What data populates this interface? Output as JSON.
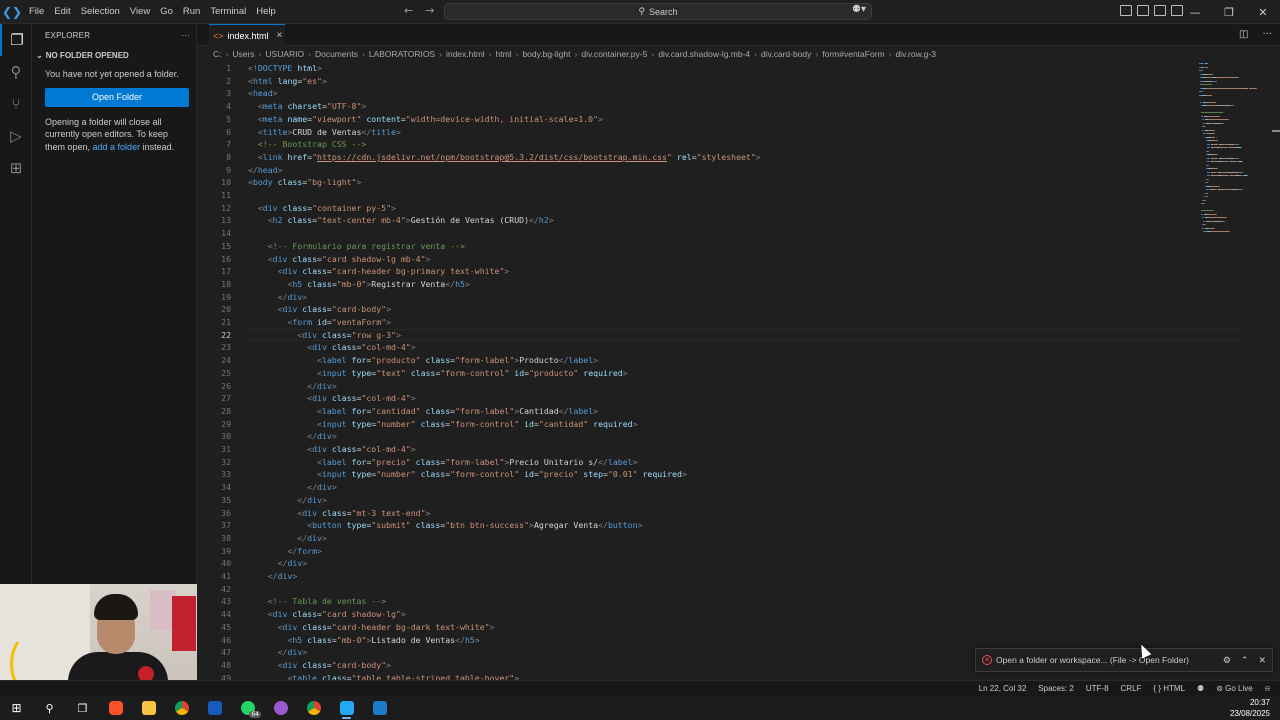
{
  "app": {
    "logo": "vscode-icon"
  },
  "menu": [
    "File",
    "Edit",
    "Selection",
    "View",
    "Go",
    "Run",
    "Terminal",
    "Help"
  ],
  "command_center": {
    "label": "Search"
  },
  "sidebar": {
    "title": "EXPLORER",
    "section": "NO FOLDER OPENED",
    "message": "You have not yet opened a folder.",
    "open_button": "Open Folder",
    "info_before": "Opening a folder will close all currently open editors. To keep them open, ",
    "info_link": "add a folder",
    "info_after": " instead."
  },
  "tab": {
    "label": "index.html",
    "close": "×"
  },
  "breadcrumb": [
    "C:",
    "Users",
    "USUARIO",
    "Documents",
    "LABORATORIOS",
    "index.html",
    "html",
    "body.bg-light",
    "div.container.py-5",
    "div.card.shadow-lg.mb-4",
    "div.card-body",
    "form#ventaForm",
    "div.row.g-3"
  ],
  "code_lines": [
    [
      [
        "p",
        "<!"
      ],
      [
        "t",
        "DOCTYPE"
      ],
      [
        "x",
        " "
      ],
      [
        "a",
        "html"
      ],
      [
        "p",
        ">"
      ]
    ],
    [
      [
        "p",
        "<"
      ],
      [
        "t",
        "html"
      ],
      [
        "x",
        " "
      ],
      [
        "a",
        "lang"
      ],
      [
        "x",
        "="
      ],
      [
        "s",
        "\"es\""
      ],
      [
        "p",
        ">"
      ]
    ],
    [
      [
        "p",
        "<"
      ],
      [
        "t",
        "head"
      ],
      [
        "p",
        ">"
      ]
    ],
    [
      [
        "x",
        "  "
      ],
      [
        "p",
        "<"
      ],
      [
        "t",
        "meta"
      ],
      [
        "x",
        " "
      ],
      [
        "a",
        "charset"
      ],
      [
        "x",
        "="
      ],
      [
        "s",
        "\"UTF-8\""
      ],
      [
        "p",
        ">"
      ]
    ],
    [
      [
        "x",
        "  "
      ],
      [
        "p",
        "<"
      ],
      [
        "t",
        "meta"
      ],
      [
        "x",
        " "
      ],
      [
        "a",
        "name"
      ],
      [
        "x",
        "="
      ],
      [
        "s",
        "\"viewport\""
      ],
      [
        "x",
        " "
      ],
      [
        "a",
        "content"
      ],
      [
        "x",
        "="
      ],
      [
        "s",
        "\"width=device-width, initial-scale=1.0\""
      ],
      [
        "p",
        ">"
      ]
    ],
    [
      [
        "x",
        "  "
      ],
      [
        "p",
        "<"
      ],
      [
        "t",
        "title"
      ],
      [
        "p",
        ">"
      ],
      [
        "x",
        "CRUD de Ventas"
      ],
      [
        "p",
        "</"
      ],
      [
        "t",
        "title"
      ],
      [
        "p",
        ">"
      ]
    ],
    [
      [
        "x",
        "  "
      ],
      [
        "c",
        "<!-- Bootstrap CSS -->"
      ]
    ],
    [
      [
        "x",
        "  "
      ],
      [
        "p",
        "<"
      ],
      [
        "t",
        "link"
      ],
      [
        "x",
        " "
      ],
      [
        "a",
        "href"
      ],
      [
        "x",
        "="
      ],
      [
        "s",
        "\""
      ],
      [
        "u",
        "https://cdn.jsdelivr.net/npm/bootstrap@5.3.2/dist/css/bootstrap.min.css"
      ],
      [
        "s",
        "\""
      ],
      [
        "x",
        " "
      ],
      [
        "a",
        "rel"
      ],
      [
        "x",
        "="
      ],
      [
        "s",
        "\"stylesheet\""
      ],
      [
        "p",
        ">"
      ]
    ],
    [
      [
        "p",
        "</"
      ],
      [
        "t",
        "head"
      ],
      [
        "p",
        ">"
      ]
    ],
    [
      [
        "p",
        "<"
      ],
      [
        "t",
        "body"
      ],
      [
        "x",
        " "
      ],
      [
        "a",
        "class"
      ],
      [
        "x",
        "="
      ],
      [
        "s",
        "\"bg-light\""
      ],
      [
        "p",
        ">"
      ]
    ],
    [],
    [
      [
        "x",
        "  "
      ],
      [
        "p",
        "<"
      ],
      [
        "t",
        "div"
      ],
      [
        "x",
        " "
      ],
      [
        "a",
        "class"
      ],
      [
        "x",
        "="
      ],
      [
        "s",
        "\"container py-5\""
      ],
      [
        "p",
        ">"
      ]
    ],
    [
      [
        "x",
        "    "
      ],
      [
        "p",
        "<"
      ],
      [
        "t",
        "h2"
      ],
      [
        "x",
        " "
      ],
      [
        "a",
        "class"
      ],
      [
        "x",
        "="
      ],
      [
        "s",
        "\"text-center mb-4\""
      ],
      [
        "p",
        ">"
      ],
      [
        "x",
        "Gestión de Ventas (CRUD)"
      ],
      [
        "p",
        "</"
      ],
      [
        "t",
        "h2"
      ],
      [
        "p",
        ">"
      ]
    ],
    [],
    [
      [
        "x",
        "    "
      ],
      [
        "c",
        "<!-- Formulario para registrar venta -->"
      ]
    ],
    [
      [
        "x",
        "    "
      ],
      [
        "p",
        "<"
      ],
      [
        "t",
        "div"
      ],
      [
        "x",
        " "
      ],
      [
        "a",
        "class"
      ],
      [
        "x",
        "="
      ],
      [
        "s",
        "\"card shadow-lg mb-4\""
      ],
      [
        "p",
        ">"
      ]
    ],
    [
      [
        "x",
        "      "
      ],
      [
        "p",
        "<"
      ],
      [
        "t",
        "div"
      ],
      [
        "x",
        " "
      ],
      [
        "a",
        "class"
      ],
      [
        "x",
        "="
      ],
      [
        "s",
        "\"card-header bg-primary text-white\""
      ],
      [
        "p",
        ">"
      ]
    ],
    [
      [
        "x",
        "        "
      ],
      [
        "p",
        "<"
      ],
      [
        "t",
        "h5"
      ],
      [
        "x",
        " "
      ],
      [
        "a",
        "class"
      ],
      [
        "x",
        "="
      ],
      [
        "s",
        "\"mb-0\""
      ],
      [
        "p",
        ">"
      ],
      [
        "x",
        "Registrar Venta"
      ],
      [
        "p",
        "</"
      ],
      [
        "t",
        "h5"
      ],
      [
        "p",
        ">"
      ]
    ],
    [
      [
        "x",
        "      "
      ],
      [
        "p",
        "</"
      ],
      [
        "t",
        "div"
      ],
      [
        "p",
        ">"
      ]
    ],
    [
      [
        "x",
        "      "
      ],
      [
        "p",
        "<"
      ],
      [
        "t",
        "div"
      ],
      [
        "x",
        " "
      ],
      [
        "a",
        "class"
      ],
      [
        "x",
        "="
      ],
      [
        "s",
        "\"card-body\""
      ],
      [
        "p",
        ">"
      ]
    ],
    [
      [
        "x",
        "        "
      ],
      [
        "p",
        "<"
      ],
      [
        "t",
        "form"
      ],
      [
        "x",
        " "
      ],
      [
        "a",
        "id"
      ],
      [
        "x",
        "="
      ],
      [
        "s",
        "\"ventaForm\""
      ],
      [
        "p",
        ">"
      ]
    ],
    [
      [
        "x",
        "          "
      ],
      [
        "p",
        "<"
      ],
      [
        "t",
        "div"
      ],
      [
        "x",
        " "
      ],
      [
        "a",
        "class"
      ],
      [
        "x",
        "="
      ],
      [
        "s",
        "\"row g-3\""
      ],
      [
        "p",
        ">"
      ]
    ],
    [
      [
        "x",
        "            "
      ],
      [
        "p",
        "<"
      ],
      [
        "t",
        "div"
      ],
      [
        "x",
        " "
      ],
      [
        "a",
        "class"
      ],
      [
        "x",
        "="
      ],
      [
        "s",
        "\"col-md-4\""
      ],
      [
        "p",
        ">"
      ]
    ],
    [
      [
        "x",
        "              "
      ],
      [
        "p",
        "<"
      ],
      [
        "t",
        "label"
      ],
      [
        "x",
        " "
      ],
      [
        "a",
        "for"
      ],
      [
        "x",
        "="
      ],
      [
        "s",
        "\"producto\""
      ],
      [
        "x",
        " "
      ],
      [
        "a",
        "class"
      ],
      [
        "x",
        "="
      ],
      [
        "s",
        "\"form-label\""
      ],
      [
        "p",
        ">"
      ],
      [
        "x",
        "Producto"
      ],
      [
        "p",
        "</"
      ],
      [
        "t",
        "label"
      ],
      [
        "p",
        ">"
      ]
    ],
    [
      [
        "x",
        "              "
      ],
      [
        "p",
        "<"
      ],
      [
        "t",
        "input"
      ],
      [
        "x",
        " "
      ],
      [
        "a",
        "type"
      ],
      [
        "x",
        "="
      ],
      [
        "s",
        "\"text\""
      ],
      [
        "x",
        " "
      ],
      [
        "a",
        "class"
      ],
      [
        "x",
        "="
      ],
      [
        "s",
        "\"form-control\""
      ],
      [
        "x",
        " "
      ],
      [
        "a",
        "id"
      ],
      [
        "x",
        "="
      ],
      [
        "s",
        "\"producto\""
      ],
      [
        "x",
        " "
      ],
      [
        "a",
        "required"
      ],
      [
        "p",
        ">"
      ]
    ],
    [
      [
        "x",
        "            "
      ],
      [
        "p",
        "</"
      ],
      [
        "t",
        "div"
      ],
      [
        "p",
        ">"
      ]
    ],
    [
      [
        "x",
        "            "
      ],
      [
        "p",
        "<"
      ],
      [
        "t",
        "div"
      ],
      [
        "x",
        " "
      ],
      [
        "a",
        "class"
      ],
      [
        "x",
        "="
      ],
      [
        "s",
        "\"col-md-4\""
      ],
      [
        "p",
        ">"
      ]
    ],
    [
      [
        "x",
        "              "
      ],
      [
        "p",
        "<"
      ],
      [
        "t",
        "label"
      ],
      [
        "x",
        " "
      ],
      [
        "a",
        "for"
      ],
      [
        "x",
        "="
      ],
      [
        "s",
        "\"cantidad\""
      ],
      [
        "x",
        " "
      ],
      [
        "a",
        "class"
      ],
      [
        "x",
        "="
      ],
      [
        "s",
        "\"form-label\""
      ],
      [
        "p",
        ">"
      ],
      [
        "x",
        "Cantidad"
      ],
      [
        "p",
        "</"
      ],
      [
        "t",
        "label"
      ],
      [
        "p",
        ">"
      ]
    ],
    [
      [
        "x",
        "              "
      ],
      [
        "p",
        "<"
      ],
      [
        "t",
        "input"
      ],
      [
        "x",
        " "
      ],
      [
        "a",
        "type"
      ],
      [
        "x",
        "="
      ],
      [
        "s",
        "\"number\""
      ],
      [
        "x",
        " "
      ],
      [
        "a",
        "class"
      ],
      [
        "x",
        "="
      ],
      [
        "s",
        "\"form-control\""
      ],
      [
        "x",
        " "
      ],
      [
        "a",
        "id"
      ],
      [
        "x",
        "="
      ],
      [
        "s",
        "\"cantidad\""
      ],
      [
        "x",
        " "
      ],
      [
        "a",
        "required"
      ],
      [
        "p",
        ">"
      ]
    ],
    [
      [
        "x",
        "            "
      ],
      [
        "p",
        "</"
      ],
      [
        "t",
        "div"
      ],
      [
        "p",
        ">"
      ]
    ],
    [
      [
        "x",
        "            "
      ],
      [
        "p",
        "<"
      ],
      [
        "t",
        "div"
      ],
      [
        "x",
        " "
      ],
      [
        "a",
        "class"
      ],
      [
        "x",
        "="
      ],
      [
        "s",
        "\"col-md-4\""
      ],
      [
        "p",
        ">"
      ]
    ],
    [
      [
        "x",
        "              "
      ],
      [
        "p",
        "<"
      ],
      [
        "t",
        "label"
      ],
      [
        "x",
        " "
      ],
      [
        "a",
        "for"
      ],
      [
        "x",
        "="
      ],
      [
        "s",
        "\"precio\""
      ],
      [
        "x",
        " "
      ],
      [
        "a",
        "class"
      ],
      [
        "x",
        "="
      ],
      [
        "s",
        "\"form-label\""
      ],
      [
        "p",
        ">"
      ],
      [
        "x",
        "Precio Unitario s/"
      ],
      [
        "p",
        "</"
      ],
      [
        "t",
        "label"
      ],
      [
        "p",
        ">"
      ]
    ],
    [
      [
        "x",
        "              "
      ],
      [
        "p",
        "<"
      ],
      [
        "t",
        "input"
      ],
      [
        "x",
        " "
      ],
      [
        "a",
        "type"
      ],
      [
        "x",
        "="
      ],
      [
        "s",
        "\"number\""
      ],
      [
        "x",
        " "
      ],
      [
        "a",
        "class"
      ],
      [
        "x",
        "="
      ],
      [
        "s",
        "\"form-control\""
      ],
      [
        "x",
        " "
      ],
      [
        "a",
        "id"
      ],
      [
        "x",
        "="
      ],
      [
        "s",
        "\"precio\""
      ],
      [
        "x",
        " "
      ],
      [
        "a",
        "step"
      ],
      [
        "x",
        "="
      ],
      [
        "s",
        "\"0.01\""
      ],
      [
        "x",
        " "
      ],
      [
        "a",
        "required"
      ],
      [
        "p",
        ">"
      ]
    ],
    [
      [
        "x",
        "            "
      ],
      [
        "p",
        "</"
      ],
      [
        "t",
        "div"
      ],
      [
        "p",
        ">"
      ]
    ],
    [
      [
        "x",
        "          "
      ],
      [
        "p",
        "</"
      ],
      [
        "t",
        "div"
      ],
      [
        "p",
        ">"
      ]
    ],
    [
      [
        "x",
        "          "
      ],
      [
        "p",
        "<"
      ],
      [
        "t",
        "div"
      ],
      [
        "x",
        " "
      ],
      [
        "a",
        "class"
      ],
      [
        "x",
        "="
      ],
      [
        "s",
        "\"mt-3 text-end\""
      ],
      [
        "p",
        ">"
      ]
    ],
    [
      [
        "x",
        "            "
      ],
      [
        "p",
        "<"
      ],
      [
        "t",
        "button"
      ],
      [
        "x",
        " "
      ],
      [
        "a",
        "type"
      ],
      [
        "x",
        "="
      ],
      [
        "s",
        "\"submit\""
      ],
      [
        "x",
        " "
      ],
      [
        "a",
        "class"
      ],
      [
        "x",
        "="
      ],
      [
        "s",
        "\"btn btn-success\""
      ],
      [
        "p",
        ">"
      ],
      [
        "x",
        "Agregar Venta"
      ],
      [
        "p",
        "</"
      ],
      [
        "t",
        "button"
      ],
      [
        "p",
        ">"
      ]
    ],
    [
      [
        "x",
        "          "
      ],
      [
        "p",
        "</"
      ],
      [
        "t",
        "div"
      ],
      [
        "p",
        ">"
      ]
    ],
    [
      [
        "x",
        "        "
      ],
      [
        "p",
        "</"
      ],
      [
        "t",
        "form"
      ],
      [
        "p",
        ">"
      ]
    ],
    [
      [
        "x",
        "      "
      ],
      [
        "p",
        "</"
      ],
      [
        "t",
        "div"
      ],
      [
        "p",
        ">"
      ]
    ],
    [
      [
        "x",
        "    "
      ],
      [
        "p",
        "</"
      ],
      [
        "t",
        "div"
      ],
      [
        "p",
        ">"
      ]
    ],
    [],
    [
      [
        "x",
        "    "
      ],
      [
        "c",
        "<!-- Tabla de ventas -->"
      ]
    ],
    [
      [
        "x",
        "    "
      ],
      [
        "p",
        "<"
      ],
      [
        "t",
        "div"
      ],
      [
        "x",
        " "
      ],
      [
        "a",
        "class"
      ],
      [
        "x",
        "="
      ],
      [
        "s",
        "\"card shadow-lg\""
      ],
      [
        "p",
        ">"
      ]
    ],
    [
      [
        "x",
        "      "
      ],
      [
        "p",
        "<"
      ],
      [
        "t",
        "div"
      ],
      [
        "x",
        " "
      ],
      [
        "a",
        "class"
      ],
      [
        "x",
        "="
      ],
      [
        "s",
        "\"card-header bg-dark text-white\""
      ],
      [
        "p",
        ">"
      ]
    ],
    [
      [
        "x",
        "        "
      ],
      [
        "p",
        "<"
      ],
      [
        "t",
        "h5"
      ],
      [
        "x",
        " "
      ],
      [
        "a",
        "class"
      ],
      [
        "x",
        "="
      ],
      [
        "s",
        "\"mb-0\""
      ],
      [
        "p",
        ">"
      ],
      [
        "x",
        "Listado de Ventas"
      ],
      [
        "p",
        "</"
      ],
      [
        "t",
        "h5"
      ],
      [
        "p",
        ">"
      ]
    ],
    [
      [
        "x",
        "      "
      ],
      [
        "p",
        "</"
      ],
      [
        "t",
        "div"
      ],
      [
        "p",
        ">"
      ]
    ],
    [
      [
        "x",
        "      "
      ],
      [
        "p",
        "<"
      ],
      [
        "t",
        "div"
      ],
      [
        "x",
        " "
      ],
      [
        "a",
        "class"
      ],
      [
        "x",
        "="
      ],
      [
        "s",
        "\"card-body\""
      ],
      [
        "p",
        ">"
      ]
    ],
    [
      [
        "x",
        "        "
      ],
      [
        "p",
        "<"
      ],
      [
        "t",
        "table"
      ],
      [
        "x",
        " "
      ],
      [
        "a",
        "class"
      ],
      [
        "x",
        "="
      ],
      [
        "s",
        "\"table table-striped table-hover\""
      ],
      [
        "p",
        ">"
      ]
    ]
  ],
  "editor": {
    "current_line": 22
  },
  "notification": {
    "message": "Open a folder or workspace... (File -> Open Folder)"
  },
  "statusbar": {
    "position": "Ln 22, Col 32",
    "indent": "Spaces: 2",
    "encoding": "UTF-8",
    "eol": "CRLF",
    "language": "HTML",
    "go_live": "Go Live"
  },
  "taskbar": {
    "clock_time": "20:37",
    "clock_date": "23/08/2025",
    "whatsapp_badge": "64"
  },
  "colors": {
    "accent": "#0078d4",
    "tag": "#569cd6",
    "attr": "#9cdcfe",
    "string": "#ce9178",
    "comment": "#6a9955"
  }
}
